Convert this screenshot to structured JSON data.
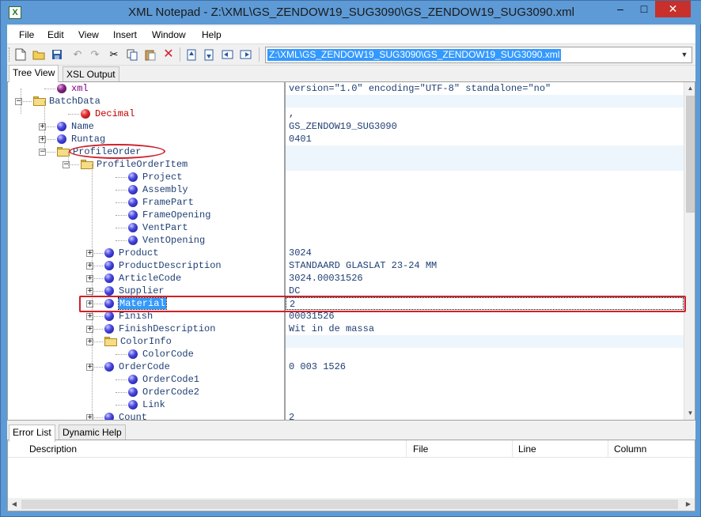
{
  "window": {
    "title": "XML Notepad - Z:\\XML\\GS_ZENDOW19_SUG3090\\GS_ZENDOW19_SUG3090.xml",
    "app_icon": "X",
    "controls": {
      "minimize": "–",
      "maximize": "□",
      "close": "✕"
    }
  },
  "menu": [
    "File",
    "Edit",
    "View",
    "Insert",
    "Window",
    "Help"
  ],
  "toolbar": {
    "icons": [
      "new-file-icon",
      "open-folder-icon",
      "save-icon",
      "undo-icon",
      "redo-icon",
      "cut-icon",
      "copy-icon",
      "paste-icon",
      "delete-icon",
      "nudge-up-icon",
      "nudge-down-icon",
      "nudge-left-icon",
      "nudge-right-icon"
    ],
    "location": "Z:\\XML\\GS_ZENDOW19_SUG3090\\GS_ZENDOW19_SUG3090.xml"
  },
  "tabs": {
    "tree_view": "Tree View",
    "xsl_output": "XSL Output"
  },
  "tree": [
    {
      "label": "xml",
      "type": "pi",
      "depth": 1,
      "expander": "",
      "value": "version=\"1.0\" encoding=\"UTF-8\" standalone=\"no\"",
      "container": false
    },
    {
      "label": "BatchData",
      "type": "folder",
      "depth": 0,
      "expander": "−",
      "value": "",
      "container": true
    },
    {
      "label": "Decimal",
      "type": "attr",
      "depth": 2,
      "expander": "",
      "value": ",",
      "container": false
    },
    {
      "label": "Name",
      "type": "elem",
      "depth": 1,
      "expander": "+",
      "value": "GS_ZENDOW19_SUG3090",
      "container": false
    },
    {
      "label": "Runtag",
      "type": "elem",
      "depth": 1,
      "expander": "+",
      "value": "0401",
      "container": false
    },
    {
      "label": "ProfileOrder",
      "type": "folder",
      "depth": 1,
      "expander": "−",
      "value": "",
      "container": true
    },
    {
      "label": "ProfileOrderItem",
      "type": "folder",
      "depth": 2,
      "expander": "−",
      "value": "",
      "container": true
    },
    {
      "label": "Project",
      "type": "elem",
      "depth": 4,
      "expander": "",
      "value": "",
      "container": false
    },
    {
      "label": "Assembly",
      "type": "elem",
      "depth": 4,
      "expander": "",
      "value": "",
      "container": false
    },
    {
      "label": "FramePart",
      "type": "elem",
      "depth": 4,
      "expander": "",
      "value": "",
      "container": false
    },
    {
      "label": "FrameOpening",
      "type": "elem",
      "depth": 4,
      "expander": "",
      "value": "",
      "container": false
    },
    {
      "label": "VentPart",
      "type": "elem",
      "depth": 4,
      "expander": "",
      "value": "",
      "container": false
    },
    {
      "label": "VentOpening",
      "type": "elem",
      "depth": 4,
      "expander": "",
      "value": "",
      "container": false
    },
    {
      "label": "Product",
      "type": "elem",
      "depth": 3,
      "expander": "+",
      "value": "3024",
      "container": false
    },
    {
      "label": "ProductDescription",
      "type": "elem",
      "depth": 3,
      "expander": "+",
      "value": "STANDAARD GLASLAT 23-24 MM",
      "container": false
    },
    {
      "label": "ArticleCode",
      "type": "elem",
      "depth": 3,
      "expander": "+",
      "value": "3024.00031526",
      "container": false
    },
    {
      "label": "Supplier",
      "type": "elem",
      "depth": 3,
      "expander": "+",
      "value": "DC",
      "container": false
    },
    {
      "label": "Material",
      "type": "elem",
      "depth": 3,
      "expander": "+",
      "value": "2",
      "container": false,
      "selected": true
    },
    {
      "label": "Finish",
      "type": "elem",
      "depth": 3,
      "expander": "+",
      "value": "00031526",
      "container": false
    },
    {
      "label": "FinishDescription",
      "type": "elem",
      "depth": 3,
      "expander": "+",
      "value": "Wit in de massa",
      "container": false
    },
    {
      "label": "ColorInfo",
      "type": "folder",
      "depth": 3,
      "expander": "+",
      "value": "",
      "container": true
    },
    {
      "label": "ColorCode",
      "type": "elem",
      "depth": 4,
      "expander": "",
      "value": "",
      "container": false
    },
    {
      "label": "OrderCode",
      "type": "elem",
      "depth": 3,
      "expander": "+",
      "value": "0 003 1526",
      "container": false
    },
    {
      "label": "OrderCode1",
      "type": "elem",
      "depth": 4,
      "expander": "",
      "value": "",
      "container": false
    },
    {
      "label": "OrderCode2",
      "type": "elem",
      "depth": 4,
      "expander": "",
      "value": "",
      "container": false
    },
    {
      "label": "Link",
      "type": "elem",
      "depth": 4,
      "expander": "",
      "value": "",
      "container": false
    },
    {
      "label": "Count",
      "type": "elem",
      "depth": 3,
      "expander": "+",
      "value": "2",
      "container": false
    }
  ],
  "bottom_tabs": {
    "error_list": "Error List",
    "dynamic_help": "Dynamic Help"
  },
  "error_list": {
    "columns": [
      "Description",
      "File",
      "Line",
      "Column"
    ]
  },
  "colors": {
    "title_bar": "#5d9ad6",
    "close_button": "#c7302b",
    "selection": "#3399ff",
    "highlight": "#d0202a",
    "node_text": "#1f3f74"
  }
}
